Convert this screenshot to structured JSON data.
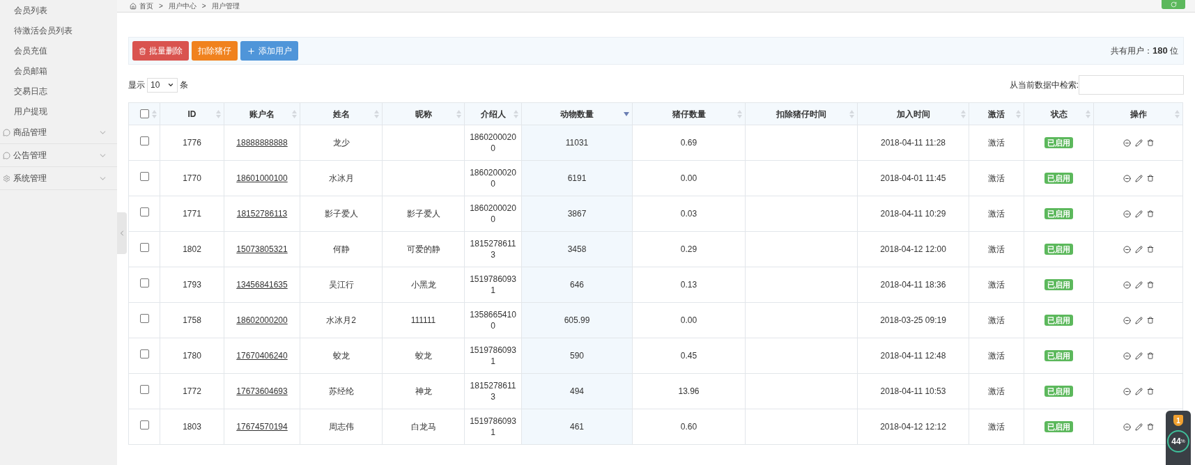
{
  "sidebar": {
    "items": [
      {
        "label": "会员列表",
        "selected": false
      },
      {
        "label": "待激活会员列表",
        "selected": false
      },
      {
        "label": "会员充值",
        "selected": false
      },
      {
        "label": "会员邮箱",
        "selected": false
      },
      {
        "label": "交易日志",
        "selected": false
      },
      {
        "label": "用户提现",
        "selected": false
      }
    ],
    "groups": [
      {
        "label": "商品管理",
        "kind": "chat",
        "expanded": false
      },
      {
        "label": "公告管理",
        "kind": "chat",
        "expanded": false
      },
      {
        "label": "系统管理",
        "kind": "gear",
        "expanded": false
      }
    ]
  },
  "breadcrumb": {
    "separator": ">",
    "items": [
      "首页",
      "用户中心",
      "用户管理"
    ]
  },
  "toolbar": {
    "buttons": [
      {
        "label": "批量删除",
        "kind": "danger"
      },
      {
        "label": "扣除猪仔",
        "kind": "warning"
      },
      {
        "label": "添加用户",
        "kind": "primary"
      }
    ],
    "total_label": "共有用户：",
    "total": "180",
    "total_unit": "位"
  },
  "page_size": {
    "prefix": "显示",
    "value": "10",
    "suffix": "条"
  },
  "search": {
    "label": "从当前数据中检索:"
  },
  "table": {
    "columns": [
      {
        "kind": "checkbox",
        "checked": false,
        "sorted": false
      },
      {
        "label": "ID",
        "sorted": false
      },
      {
        "label": "账户名",
        "sorted": false
      },
      {
        "label": "姓名",
        "sorted": false
      },
      {
        "label": "昵称",
        "sorted": false
      },
      {
        "label": "介绍人",
        "sorted": false
      },
      {
        "label": "动物数量",
        "sorted": true
      },
      {
        "label": "猪仔数量",
        "sorted": false
      },
      {
        "label": "扣除猪仔时间",
        "sorted": false
      },
      {
        "label": "加入时间",
        "sorted": false
      },
      {
        "label": "激活",
        "sorted": false
      },
      {
        "label": "状态",
        "sorted": false
      },
      {
        "label": "操作",
        "sorted": false
      }
    ],
    "rows": [
      {
        "checked": false,
        "id": "1776",
        "account": "18888888888",
        "name": "龙少",
        "referrer": "18602000200",
        "animals": "11031",
        "piglets": "0.69",
        "joined": "2018-04-11 11:28",
        "activation": "激活",
        "status": "已启用",
        "enabled": true
      },
      {
        "checked": false,
        "id": "1770",
        "account": "18601000100",
        "name": "水冰月",
        "referrer": "18602000200",
        "animals": "6191",
        "piglets": "0.00",
        "joined": "2018-04-01 11:45",
        "activation": "激活",
        "status": "已启用",
        "enabled": true
      },
      {
        "checked": false,
        "id": "1771",
        "account": "18152786113",
        "name": "影子爱人",
        "nickname": "影子爱人",
        "referrer": "18602000200",
        "animals": "3867",
        "piglets": "0.03",
        "joined": "2018-04-11 10:29",
        "activation": "激活",
        "status": "已启用",
        "enabled": true
      },
      {
        "checked": false,
        "id": "1802",
        "account": "15073805321",
        "name": "何静",
        "nickname": "可爱的静",
        "referrer": "18152786113",
        "animals": "3458",
        "piglets": "0.29",
        "joined": "2018-04-12 12:00",
        "activation": "激活",
        "status": "已启用",
        "enabled": true
      },
      {
        "checked": false,
        "id": "1793",
        "account": "13456841635",
        "name": "吴江行",
        "nickname": "小黑龙",
        "referrer": "15197860931",
        "animals": "646",
        "piglets": "0.13",
        "joined": "2018-04-11 18:36",
        "activation": "激活",
        "status": "已启用",
        "enabled": true
      },
      {
        "checked": false,
        "id": "1758",
        "account": "18602000200",
        "name": "水冰月2",
        "nickname": "111111",
        "referrer": "13586654100",
        "animals": "605.99",
        "piglets": "0.00",
        "joined": "2018-03-25 09:19",
        "activation": "激活",
        "status": "已启用",
        "enabled": true
      },
      {
        "checked": false,
        "id": "1780",
        "account": "17670406240",
        "name": "蛟龙",
        "nickname": "蛟龙",
        "referrer": "15197860931",
        "animals": "590",
        "piglets": "0.45",
        "joined": "2018-04-11 12:48",
        "activation": "激活",
        "status": "已启用",
        "enabled": true
      },
      {
        "checked": false,
        "id": "1772",
        "account": "17673604693",
        "name": "苏经纶",
        "nickname": "神龙",
        "referrer": "18152786113",
        "animals": "494",
        "piglets": "13.96",
        "joined": "2018-04-11 10:53",
        "activation": "激活",
        "status": "已启用",
        "enabled": true
      },
      {
        "checked": false,
        "id": "1803",
        "account": "17674570194",
        "name": "周志伟",
        "nickname": "白龙马",
        "referrer": "15197860931",
        "animals": "461",
        "piglets": "0.60",
        "joined": "2018-04-12 12:12",
        "activation": "激活",
        "status": "已启用",
        "enabled": true
      }
    ]
  },
  "widget": {
    "badge": "1",
    "percent": "44",
    "unit": "%"
  }
}
